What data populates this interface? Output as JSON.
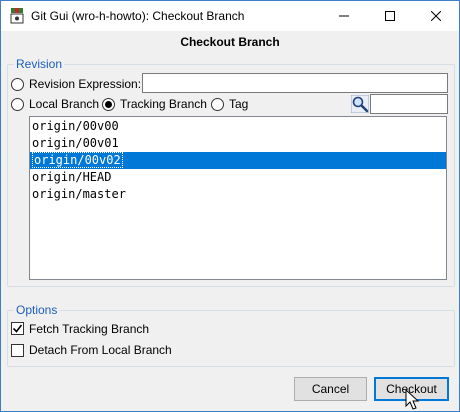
{
  "window": {
    "title": "Git Gui (wro-h-howto): Checkout Branch"
  },
  "dialog": {
    "heading": "Checkout Branch"
  },
  "revision": {
    "legend": "Revision",
    "expression_label": "Revision Expression:",
    "expression_value": "",
    "source_options": [
      {
        "label": "Local Branch",
        "selected": false
      },
      {
        "label": "Tracking Branch",
        "selected": true
      },
      {
        "label": "Tag",
        "selected": false
      }
    ],
    "filter_value": "",
    "branches": [
      {
        "name": "origin/00v00",
        "selected": false
      },
      {
        "name": "origin/00v01",
        "selected": false
      },
      {
        "name": "origin/00v02",
        "selected": true
      },
      {
        "name": "origin/HEAD",
        "selected": false
      },
      {
        "name": "origin/master",
        "selected": false
      }
    ]
  },
  "options": {
    "legend": "Options",
    "fetch_tracking_label": "Fetch Tracking Branch",
    "fetch_tracking_checked": true,
    "detach_label": "Detach From Local Branch",
    "detach_checked": false
  },
  "buttons": {
    "cancel_label": "Cancel",
    "checkout_label": "Checkout"
  },
  "colors": {
    "selection": "#0078d7",
    "legend_text": "#1c5dbd"
  },
  "icons": {
    "app": "git-gui-icon",
    "filter": "magnifier-icon"
  }
}
